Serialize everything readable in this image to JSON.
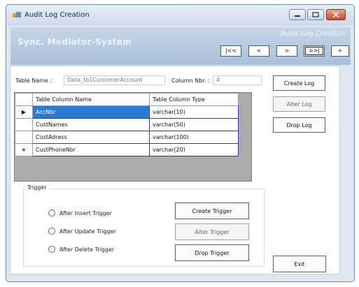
{
  "window": {
    "title": "Audit Log Creation",
    "controls": {
      "minimize": "–",
      "maximize": "□",
      "close": "✕"
    }
  },
  "header": {
    "brand": "Sync. Mediator-System",
    "caption": "Audit Log Creation",
    "nav": {
      "first": "|<<",
      "prev": "<",
      "next": ">",
      "last": ">>|",
      "add": "+"
    }
  },
  "form": {
    "table_name_label": "Table Name :",
    "table_name_value": "Data_tb1CustomerAccount",
    "column_nbr_label": "Column Nbr. :",
    "column_nbr_value": "4"
  },
  "grid": {
    "columns": [
      "Table Column Name",
      "Table Column Type"
    ],
    "rows": [
      {
        "marker": "▶",
        "name": "AccNbr",
        "type": "varchar(10)"
      },
      {
        "marker": "",
        "name": "CustNames",
        "type": "varchar(50)"
      },
      {
        "marker": "",
        "name": "CustAdress",
        "type": "varchar(100)"
      },
      {
        "marker": "∗",
        "name": "CustPhoneNbr",
        "type": "varchar(20)"
      }
    ]
  },
  "log_buttons": {
    "create": "Create Log",
    "alter": "Alter Log",
    "drop": "Drop Log"
  },
  "trigger": {
    "group_label": "Trigger",
    "options": [
      "After Insert Trigger",
      "After Update Trigger",
      "After Delete Trigger"
    ],
    "buttons": {
      "create": "Create Trigger",
      "alter": "Alter Trigger",
      "drop": "Drop Trigger"
    }
  },
  "exit_label": "Exit"
}
